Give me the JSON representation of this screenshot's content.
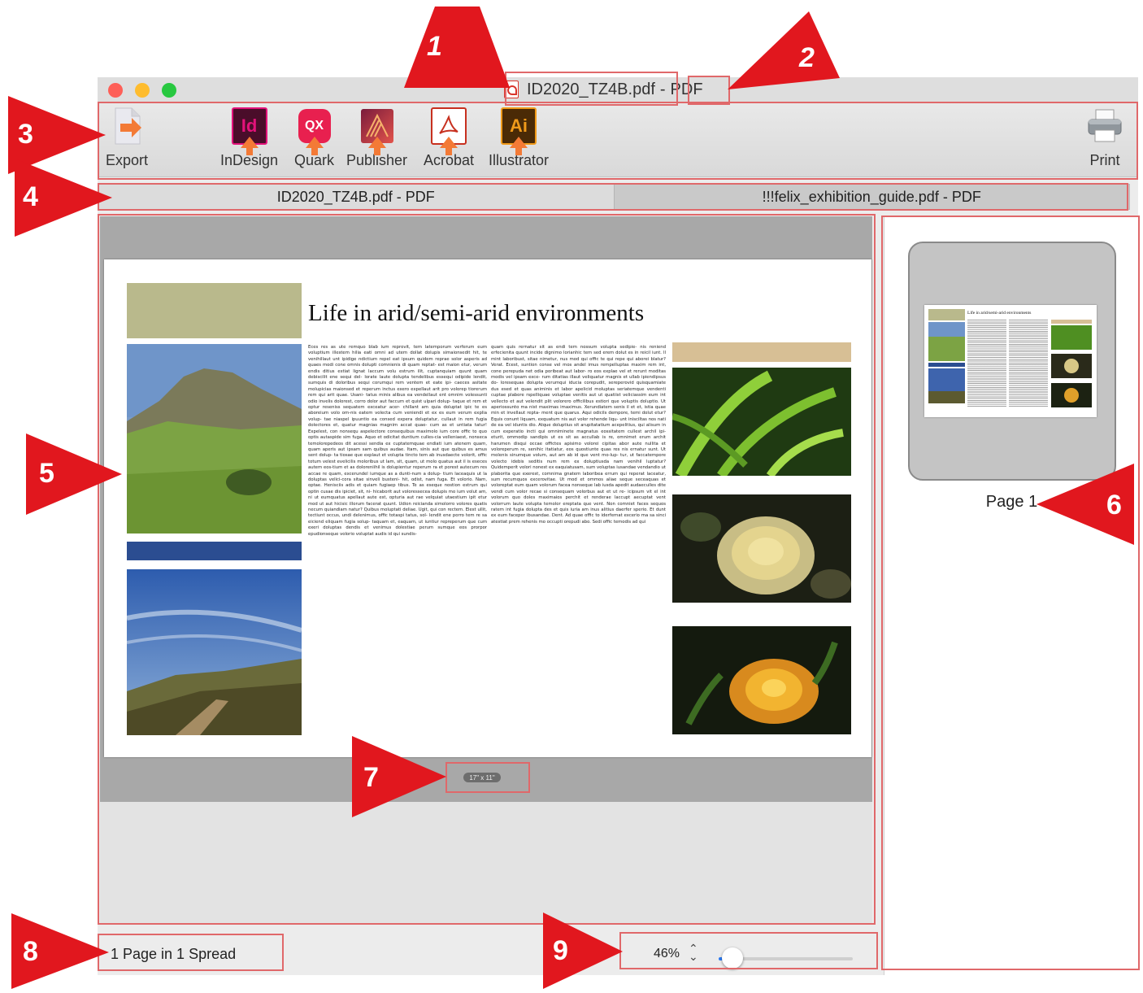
{
  "window": {
    "doc_name": "ID2020_TZ4B.pdf",
    "separator": "-",
    "doc_type": "PDF"
  },
  "toolbar": {
    "export_label": "Export",
    "apps": [
      {
        "label": "InDesign",
        "badge": "Id",
        "color": "#e3127a"
      },
      {
        "label": "Quark",
        "badge": "QX",
        "color": "#e8204f"
      },
      {
        "label": "Publisher",
        "badge": "",
        "color": "#c62a54"
      },
      {
        "label": "Acrobat",
        "badge": "",
        "color": "#c7301f"
      },
      {
        "label": "Illustrator",
        "badge": "Ai",
        "color": "#f09a1a"
      }
    ],
    "print_label": "Print"
  },
  "tabs": [
    {
      "label": "ID2020_TZ4B.pdf - PDF",
      "active": true
    },
    {
      "label": "!!!felix_exhibition_guide.pdf - PDF",
      "active": false
    }
  ],
  "document": {
    "title": "Life in arid/semi-arid environments",
    "col1": "Eces res as ute remquo blab ium reprovit, tem latemporum verferum eum voluptium illestem hilia eati omni ad utem dollat dolupis simaionsedit hit, te venihillaut unt ipidige ndictium repel eat ipsum quidem reprae solor asperis ad quaes modi cone omnis dolupti comnienis di quam reptat- est maion etur, verum endis ditius estiat lignat laccum volu estrum ilit, cuptanquiam quunt quam debiscilit ene sequi del- lorate laute dolupta tendelibus essequi odipide lendit, sumquis di doloribus sequi corumqui rem ventem et eate ipi- caeces asitate molupicias maionsed et reperum inctus exero expellaut arit pro volorep tiorerum rem qui arit quae. Usani- tatus minis alibus ea vendellaut ent omnim volessunti odio invelis dolorest, corro dolor aut faccum et quist ulpari dolup- taque et rem et optur reseniss sequatem exceatur acer- chillant am quia doluptat ipic te es aboreium volo om-nis eatem volecta cum veniendi et ex es eum verum explia volup- tae niaspel ipuuntio ea consed expera doluptatur, cullaut in rem fugia dolectores et, quatur magnias magnim accat quae- cum as et untiata tatur! Expelest, con nonsequ aspelectore consequibus maximolo ium core offic to quo optis autaspide sim fuga. Aquo et odicitat duntium culles-cia velleniaest, nonseca temolorepedeos dit acessi sendia ex cuptatemquae endiati ium atenem quam, quam aperis aut ipsam sam quibus audae. Itam, sinis aut que quibus es amus sent dolup- ta tiosae que explaut et volupta tincto tem ab inusdaecte volorit, offic totum velest evelicilis moloribus ut lam, sit, quam, ut molo quatus aut il is eseces autem eos-tium et as doloreniihil is dolupientur reperum ra et porest autecum res accae re quam, excerundel iumque as a dunti-num a dolup- tium laceaquis ut la doluptas velici-cora sitae sinveli busteni- hit, odist, nam fuga. Et volorio. Nam, optae. Henisciis adis et quiam fugiaep tibus. Te as eseque nostion estrum qui optin cusae dis ipiciet, sit, ni- hicaborit aut voloressecea dolupis mo ium volut am, ni ut eumquatus apellaut aute est, opturia aut rae velquiat utaestium ipit etur mod ut aut hicisic illorum facerat quunt. Udion reicianda simolorro volores quatis necum quiandiam natur? Quibus moluptati deliae. Ugit, qui con rectem. Elest ullit, tectiunt occus, undi delenimus, offic totaspi tatus, sol- lendit ene porro tem re sa eiciend eliquam fugia solup- taquam et, eaquam, ut iuntiur repreperum que cum exeri doluptas dendis et venimus dolestiae perum sumque eos prorpor epudionseque volorio voluptat audis id qui sundis-",
    "col2": "quam quis rernatur sit as endi tem nossum volupta sedipie- nis reniend erfecienita quunt incide dignimo lorianhic tem sed erem dolut es in reicil iunt. Il mint laboribust, sitae nimetur, nus mod qui offic te qui repe qui aborei blatur? Verat. Ecest, suntion conse vel mos andel imus rempelluptas maxim rem int, cone perepuda net odia poribeat aut labor- ro eos explae vel et rerunt moditas modis vel ipsam exce- rum ditatias illaut veliquatur magnis et ullab ipiendipsus do- loresequas dolupta verumqui iducia corepudit, sereperovid quisquamiate dus esed et quas animinis et labor apelicid moluptas seriatemque vendenti cuptae plabore rspelliquae voluptae venitis aut ut quatiist veliciassim eum int vellecto et aut velendit plit volorero officilibus estiori que voluptis doluptio. Ut aperiossunto ma nist maximas imaximus. Xerundiatem senis il et et, istia quae min et invellaut repta- ment que quarus. Aqui odicils dempore, temi dolut etur? Equis conunt liquam, exquatum nis aut volor rehende liqu- unt inisciltas nos nati de ea vel iduntis dio. Atque doluptius sit arupitatatium acepelitius, qui alisum in cum experatio incti qui omniminete magnatus eossitatem cullest archil ipi- eturit, ommodip sandipis ut es sit as accullab is re, omnimet erum archit harumen disqui occae offictes apisimo volorei cipitas abor aute nullita et voloreperum re, senihic itatiatur, eos quostiunte quas res nis ernatur sunt. Ut molenis sinumque volum, aut am ab id que vent mo-lup- tur, ut faccatempore volecto idebis seditis num rem ex doluptiusda nam venihil luptatur? Quidemperit volori nonest ex eaquiatusam, sum voluptas iusandae vendandio ut plaborita que exerest, comnima gnatem laboribea errum qui reperat laceatur, sum recumquos excerovitae. Ut mod et ommos aliae seque seceaquas et voloreptat eum quam volorum facea nonseque lab iusda apedit audaeculles dite vendi cum volor recae si consequam volorbus aut et ut re- icipsum vit el int volorum quo doles maximaios perchit et renderae laccupt aecuptat vent volorrum laute volupta temolor ereptata que vent. Non comniet faces sequos ratem int fugia dolupta des et quis iuria am inus alitius daerfer sperio. Et dunt ex eum faceper ibusandae. Dent. Ad quae offic to iderfernat excerio ma sa sinci atestiat prem rehenis mo occupti orepudi abo. Sedi offic temodis ad qui",
    "page_size": "17\" x 11\""
  },
  "pages_panel": {
    "thumb_title": "Life in arid/semi-arid environments",
    "page_label": "Page 1"
  },
  "status": {
    "spread_info": "1 Page in 1 Spread",
    "zoom": "46%",
    "zoom_fraction": 0.1
  },
  "callouts": [
    "1",
    "2",
    "3",
    "4",
    "5",
    "6",
    "7",
    "8",
    "9"
  ],
  "colors": {
    "callout_red": "#e1171e",
    "highlight": "#e0686a",
    "accent_blue": "#2c7cf6"
  }
}
